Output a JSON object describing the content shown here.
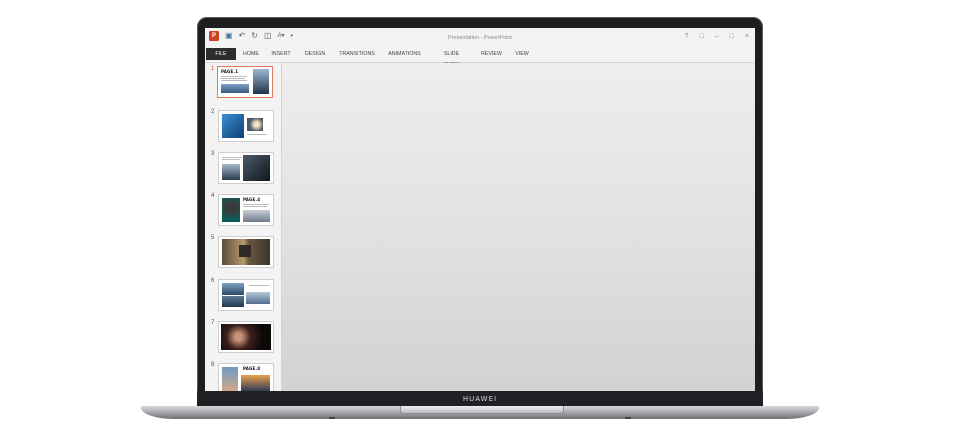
{
  "device": {
    "brand": "HUAWEI"
  },
  "window": {
    "title": "Presentation - PowerPoint",
    "app_icon": "powerpoint-icon",
    "quick_access": [
      "save-icon",
      "undo-icon",
      "redo-icon",
      "start-from-beginning-icon",
      "font-color-icon",
      "customize-qat-icon"
    ],
    "controls": [
      "help-icon",
      "ribbon-display-options-icon",
      "minimize-icon",
      "restore-icon",
      "close-icon"
    ]
  },
  "ribbon": {
    "tabs": [
      "FILE",
      "HOME",
      "INSERT",
      "DESIGN",
      "TRANSITIONS",
      "ANIMATIONS",
      "SLIDE SHOW",
      "REVIEW",
      "VIEW"
    ],
    "active": "FILE"
  },
  "slides": [
    {
      "number": "1",
      "label": "PAGE.1",
      "selected": true
    },
    {
      "number": "2",
      "label": ""
    },
    {
      "number": "3",
      "label": ""
    },
    {
      "number": "4",
      "label": "PAGE.4"
    },
    {
      "number": "5",
      "label": ""
    },
    {
      "number": "6",
      "label": ""
    },
    {
      "number": "7",
      "label": ""
    },
    {
      "number": "8",
      "label": "PAGE.8"
    }
  ],
  "colors": {
    "file_tab": "#2d2d2d",
    "selected_slide_border": "#e07a5a",
    "app_icon": "#d04423"
  }
}
